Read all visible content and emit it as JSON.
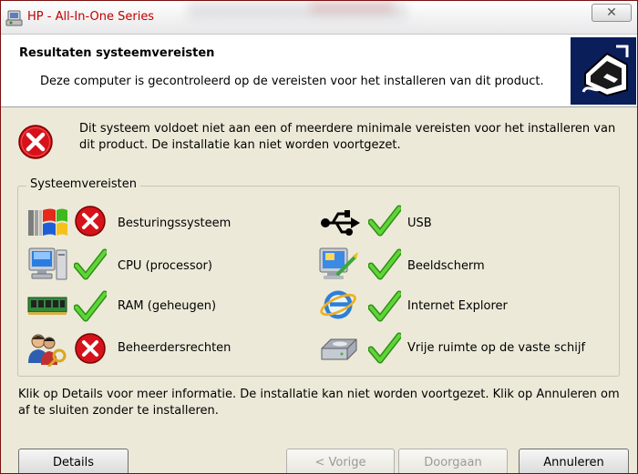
{
  "window": {
    "title": "HP - All-In-One Series",
    "close_glyph": "✕"
  },
  "header": {
    "title": "Resultaten systeemvereisten",
    "subtitle": "Deze computer is gecontroleerd op de vereisten voor het installeren van dit product."
  },
  "message": "Dit systeem voldoet niet aan een of meerdere minimale vereisten voor het installeren van dit product. De installatie kan niet worden voortgezet.",
  "requirements": {
    "group_label": "Systeemvereisten",
    "items": [
      {
        "label": "Besturingssysteem",
        "status": "fail",
        "icon": "windows-flag-icon"
      },
      {
        "label": "USB",
        "status": "pass",
        "icon": "usb-icon"
      },
      {
        "label": "CPU (processor)",
        "status": "pass",
        "icon": "computer-icon"
      },
      {
        "label": "Beeldscherm",
        "status": "pass",
        "icon": "display-icon"
      },
      {
        "label": "RAM (geheugen)",
        "status": "pass",
        "icon": "memory-module-icon"
      },
      {
        "label": "Internet Explorer",
        "status": "pass",
        "icon": "internet-explorer-icon"
      },
      {
        "label": "Beheerdersrechten",
        "status": "fail",
        "icon": "admin-users-key-icon"
      },
      {
        "label": "Vrije ruimte op de vaste schijf",
        "status": "pass",
        "icon": "hard-disk-icon"
      }
    ]
  },
  "footer_message": "Klik op Details voor meer informatie. De installatie kan niet worden voortgezet. Klik op Annuleren om af te sluiten zonder te installeren.",
  "buttons": {
    "details": "Details",
    "back": "< Vorige",
    "next": "Doorgaan",
    "cancel": "Annuleren"
  },
  "colors": {
    "title_text": "#c00000",
    "fail": "#d6121a",
    "pass": "#3fb81d",
    "background": "#ece9d8"
  }
}
